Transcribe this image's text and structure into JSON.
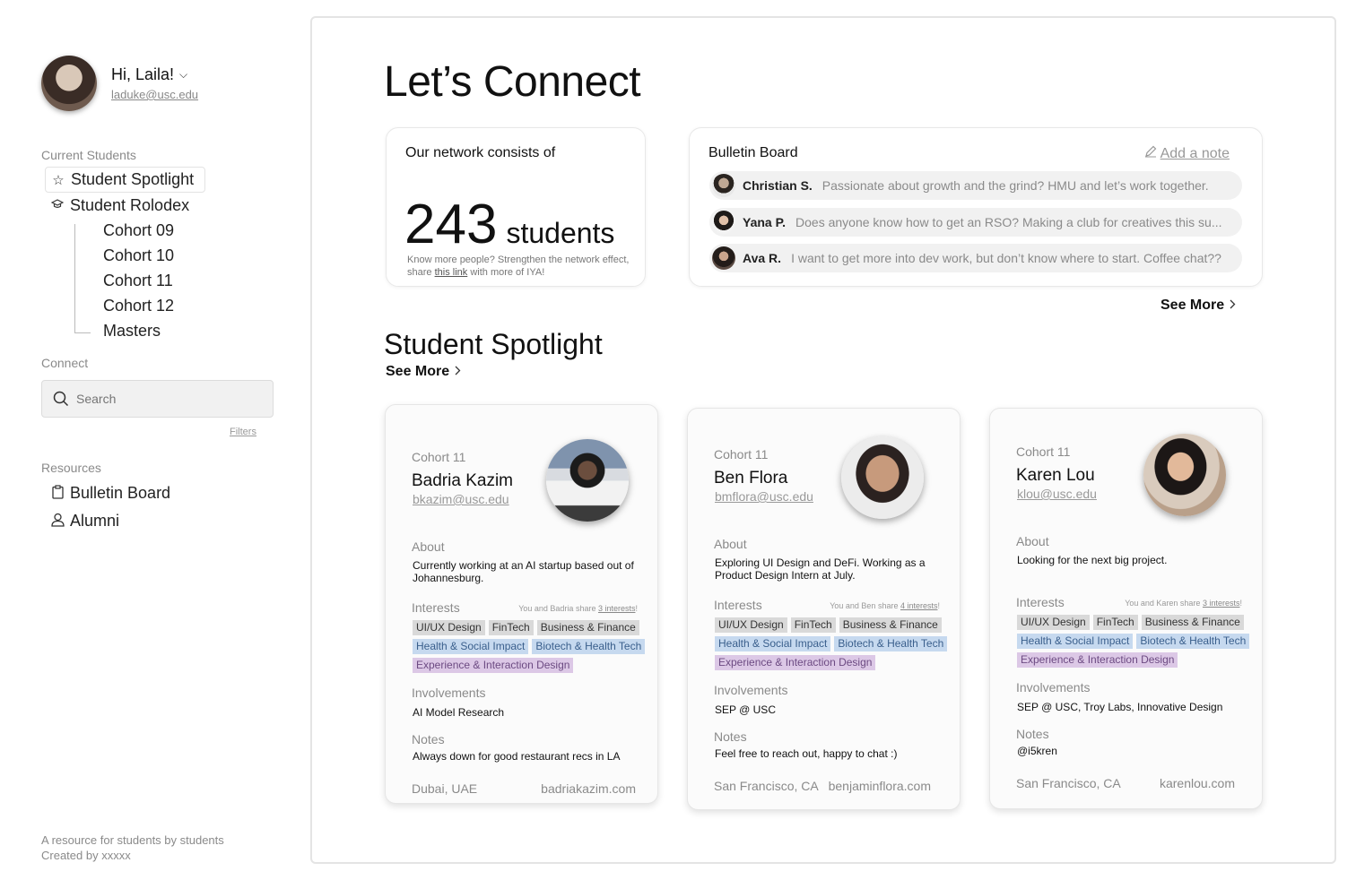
{
  "sidebar": {
    "greeting": "Hi, Laila!",
    "email": "laduke@usc.edu",
    "current_students_label": "Current Students",
    "spotlight": "Student Spotlight",
    "rolodex": "Student Rolodex",
    "cohorts": [
      "Cohort 09",
      "Cohort 10",
      "Cohort 11",
      "Cohort 12",
      "Masters"
    ],
    "connect_label": "Connect",
    "search_placeholder": "Search",
    "filters": "Filters",
    "resources_label": "Resources",
    "bulletin": "Bulletin Board",
    "alumni": "Alumni",
    "footer_line1": "A resource for students by students",
    "footer_line2": "Created by xxxxx"
  },
  "main": {
    "title": "Let’s Connect",
    "network": {
      "title": "Our network consists of",
      "count": "243",
      "unit": "students",
      "note_pre": "Know more people? Strengthen the network effect, share ",
      "note_link": "this link",
      "note_post": " with more of IYA!"
    },
    "bulletin": {
      "title": "Bulletin Board",
      "add_note": "Add a note",
      "posts": [
        {
          "name": "Christian S.",
          "message": "Passionate about growth and the grind? HMU and let’s work together."
        },
        {
          "name": "Yana P.",
          "message": "Does anyone know how to get an RSO? Making a club for creatives this su..."
        },
        {
          "name": "Ava R.",
          "message": "I want to get more into dev work, but don’t know where to start. Coffee chat??"
        }
      ],
      "see_more": "See More"
    },
    "spotlight_title": "Student Spotlight",
    "spotlight_see_more": "See More"
  },
  "cards": [
    {
      "cohort": "Cohort 11",
      "name": "Badria Kazim",
      "email": "bkazim@usc.edu",
      "about_label": "About",
      "about": "Currently working at an AI startup based out of Johannesburg.",
      "interests_label": "Interests",
      "share_pre": "You and Badria share ",
      "share_link": "3 interests",
      "share_post": "!",
      "tags": [
        {
          "text": "UI/UX Design",
          "color": "grey"
        },
        {
          "text": "FinTech",
          "color": "grey"
        },
        {
          "text": "Business & Finance",
          "color": "grey"
        },
        {
          "text": "Health & Social Impact",
          "color": "blue"
        },
        {
          "text": "Biotech & Health Tech",
          "color": "blue"
        },
        {
          "text": "Experience & Interaction Design",
          "color": "purple"
        }
      ],
      "involvements_label": "Involvements",
      "involvements": "AI Model Research",
      "notes_label": "Notes",
      "notes": "Always down for good restaurant recs in LA",
      "location": "Dubai, UAE",
      "website": "badriakazim.com"
    },
    {
      "cohort": "Cohort 11",
      "name": "Ben Flora",
      "email": "bmflora@usc.edu",
      "about_label": "About",
      "about": "Exploring UI Design and DeFi. Working as a Product Design Intern at July.",
      "interests_label": "Interests",
      "share_pre": "You and Ben share ",
      "share_link": "4 interests",
      "share_post": "!",
      "tags": [
        {
          "text": "UI/UX Design",
          "color": "grey"
        },
        {
          "text": "FinTech",
          "color": "grey"
        },
        {
          "text": "Business & Finance",
          "color": "grey"
        },
        {
          "text": "Health & Social Impact",
          "color": "blue"
        },
        {
          "text": "Biotech & Health Tech",
          "color": "blue"
        },
        {
          "text": "Experience & Interaction Design",
          "color": "purple"
        }
      ],
      "involvements_label": "Involvements",
      "involvements": "SEP @ USC",
      "notes_label": "Notes",
      "notes": "Feel free to reach out, happy to chat :)",
      "location": "San Francisco, CA",
      "website": "benjaminflora.com"
    },
    {
      "cohort": "Cohort 11",
      "name": "Karen Lou",
      "email": "klou@usc.edu",
      "about_label": "About",
      "about": "Looking for the next big project.",
      "interests_label": "Interests",
      "share_pre": "You and Karen share ",
      "share_link": "3 interests",
      "share_post": "!",
      "tags": [
        {
          "text": "UI/UX Design",
          "color": "grey"
        },
        {
          "text": "FinTech",
          "color": "grey"
        },
        {
          "text": "Business & Finance",
          "color": "grey"
        },
        {
          "text": "Health & Social Impact",
          "color": "blue"
        },
        {
          "text": "Biotech & Health Tech",
          "color": "blue"
        },
        {
          "text": "Experience & Interaction Design",
          "color": "purple"
        }
      ],
      "involvements_label": "Involvements",
      "involvements": "SEP @ USC, Troy Labs, Innovative Design",
      "notes_label": "Notes",
      "notes": "@i5kren",
      "location": "San Francisco, CA",
      "website": "karenlou.com"
    }
  ],
  "colors": {
    "tag_grey": "#d9d9d9",
    "tag_blue": "#c6d9ef",
    "tag_purple": "#dcc8e6",
    "muted_text": "#8a8a8a"
  }
}
